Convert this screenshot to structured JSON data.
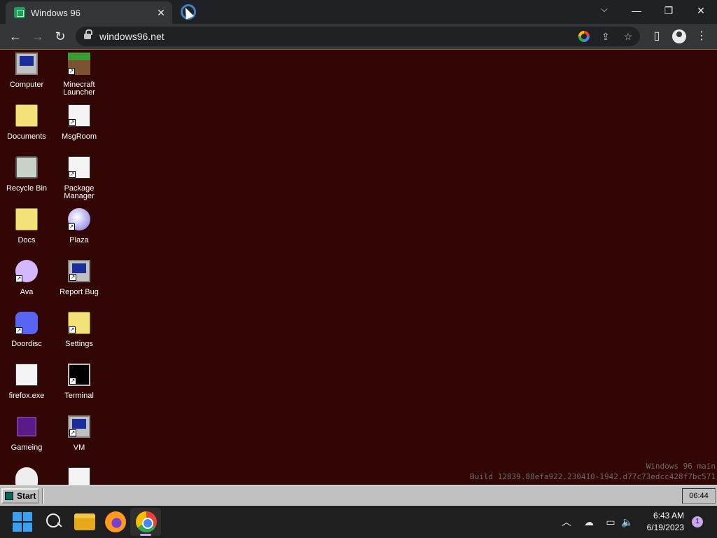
{
  "browser": {
    "tab_title": "Windows 96",
    "tab_close": "✕",
    "url": "windows96.net",
    "nav": {
      "back": "←",
      "forward": "→",
      "reload": "↻"
    },
    "window": {
      "minimize": "—",
      "restore": "❐",
      "close": "✕",
      "tab_search": "⌵"
    },
    "toolbar_icons": {
      "share": "⇪",
      "bookmark": "☆",
      "sidepanel": "▯",
      "menu": "⋮"
    }
  },
  "desktop": {
    "icons": [
      {
        "label": "Computer",
        "glyph": "monitor",
        "shortcut": false
      },
      {
        "label": "Minecraft Launcher",
        "glyph": "grass",
        "shortcut": true
      },
      {
        "label": "Documents",
        "glyph": "folder",
        "shortcut": false
      },
      {
        "label": "MsgRoom",
        "glyph": "paper",
        "shortcut": true
      },
      {
        "label": "Recycle Bin",
        "glyph": "bin",
        "shortcut": false
      },
      {
        "label": "Package Manager",
        "glyph": "paper",
        "shortcut": true
      },
      {
        "label": "Docs",
        "glyph": "folder",
        "shortcut": false
      },
      {
        "label": "Plaza",
        "glyph": "globe",
        "shortcut": true
      },
      {
        "label": "Ava",
        "glyph": "ava",
        "shortcut": true
      },
      {
        "label": "Report Bug",
        "glyph": "monitor",
        "shortcut": true
      },
      {
        "label": "Doordisc",
        "glyph": "discord",
        "shortcut": true
      },
      {
        "label": "Settings",
        "glyph": "folder",
        "shortcut": true
      },
      {
        "label": "firefox.exe",
        "glyph": "paper",
        "shortcut": false
      },
      {
        "label": "Terminal",
        "glyph": "term",
        "shortcut": true
      },
      {
        "label": "Gameing",
        "glyph": "cube",
        "shortcut": false
      },
      {
        "label": "VM",
        "glyph": "monitor",
        "shortcut": true
      },
      {
        "label": "",
        "glyph": "skull",
        "shortcut": false
      },
      {
        "label": "",
        "glyph": "paper",
        "shortcut": false
      }
    ],
    "build_line1": "Windows 96 main",
    "build_line2": "Build 12839.88efa922.230410-1942.d77c73edcc428f7bc571"
  },
  "w96_taskbar": {
    "start_label": "Start",
    "clock": "06:44"
  },
  "win_taskbar": {
    "time": "6:43 AM",
    "date": "6/19/2023",
    "notifications": "1",
    "tray": {
      "chevron": "︿",
      "cloud": "☁",
      "network": "▭",
      "volume": "🔈"
    }
  }
}
